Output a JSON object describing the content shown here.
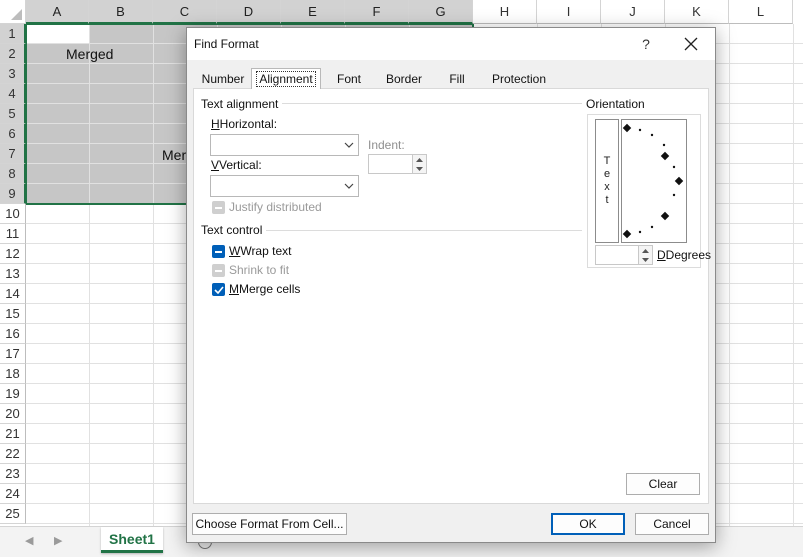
{
  "spreadsheet": {
    "columns": [
      "A",
      "B",
      "C",
      "D",
      "E",
      "F",
      "G",
      "H",
      "I",
      "J",
      "K",
      "L"
    ],
    "rows": [
      "1",
      "2",
      "3",
      "4",
      "5",
      "6",
      "7",
      "8",
      "9",
      "10",
      "11",
      "12",
      "13",
      "14",
      "15",
      "16",
      "17",
      "18",
      "19",
      "20",
      "21",
      "22",
      "23",
      "24",
      "25"
    ],
    "cells": {
      "merged_b2": "Merged",
      "merged_row7": "Mer"
    },
    "sheet_tab": "Sheet1",
    "accent_color": "#217346",
    "selection_fill": "#c6c6c6"
  },
  "dialog": {
    "title": "Find Format",
    "help_label": "?",
    "tabs": [
      {
        "label": "Number",
        "active": false
      },
      {
        "label": "Alignment",
        "active": true
      },
      {
        "label": "Font",
        "active": false
      },
      {
        "label": "Border",
        "active": false
      },
      {
        "label": "Fill",
        "active": false
      },
      {
        "label": "Protection",
        "active": false
      }
    ],
    "text_alignment": {
      "group_label": "Text alignment",
      "horizontal_label": "Horizontal:",
      "horizontal_value": "",
      "vertical_label": "Vertical:",
      "vertical_value": "",
      "indent_label": "Indent:",
      "indent_value": "",
      "justify_distributed_label": "Justify distributed"
    },
    "text_control": {
      "group_label": "Text control",
      "wrap_text_label": "Wrap text",
      "wrap_text_state": "indeterminate",
      "shrink_to_fit_label": "Shrink to fit",
      "shrink_to_fit_state": "disabled",
      "merge_cells_label": "Merge cells",
      "merge_cells_state": "checked"
    },
    "orientation": {
      "group_label": "Orientation",
      "vertical_text": [
        "T",
        "e",
        "x",
        "t"
      ],
      "degrees_label": "Degrees",
      "degrees_value": ""
    },
    "buttons": {
      "clear": "Clear",
      "choose_format": "Choose Format From Cell...",
      "ok": "OK",
      "cancel": "Cancel"
    },
    "accent_color": "#005fb8"
  }
}
